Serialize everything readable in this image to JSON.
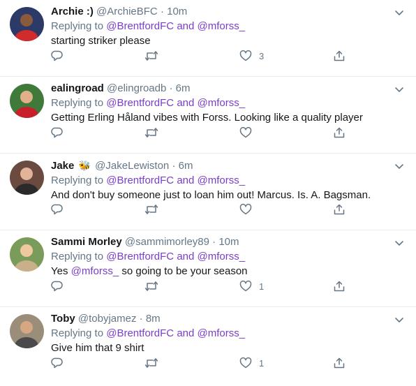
{
  "colors": {
    "link": "#7b3ec7",
    "muted": "#657786",
    "text": "#14171a",
    "divider": "#e6ecf0"
  },
  "icons": [
    "chevron-down-icon",
    "reply-icon",
    "retweet-icon",
    "like-icon",
    "share-icon"
  ],
  "tweets": [
    {
      "name": "Archie :)",
      "emoji": "",
      "handle": "@ArchieBFC",
      "separator": "·",
      "time": "10m",
      "replying_prefix": "Replying to",
      "replying_user1": "@BrentfordFC",
      "replying_and": "and",
      "replying_user2": "@mforss_",
      "text_segments": [
        {
          "text": "starting striker please",
          "link": false
        }
      ],
      "reply_count": "",
      "retweet_count": "",
      "like_count": "3"
    },
    {
      "name": "ealingroad",
      "emoji": "",
      "handle": "@elingroadb",
      "separator": "·",
      "time": "6m",
      "replying_prefix": "Replying to",
      "replying_user1": "@BrentfordFC",
      "replying_and": "and",
      "replying_user2": "@mforss_",
      "text_segments": [
        {
          "text": "Getting Erling Håland vibes with Forss. Looking like a quality player",
          "link": false
        }
      ],
      "reply_count": "",
      "retweet_count": "",
      "like_count": ""
    },
    {
      "name": "Jake",
      "emoji": "🐝",
      "handle": "@JakeLewiston",
      "separator": "·",
      "time": "6m",
      "replying_prefix": "Replying to",
      "replying_user1": "@BrentfordFC",
      "replying_and": "and",
      "replying_user2": "@mforss_",
      "text_segments": [
        {
          "text": "And don't buy someone just to loan him out! Marcus. Is. A. Bagsman.",
          "link": false
        }
      ],
      "reply_count": "",
      "retweet_count": "",
      "like_count": ""
    },
    {
      "name": "Sammi Morley",
      "emoji": "",
      "handle": "@sammimorley89",
      "separator": "·",
      "time": "10m",
      "replying_prefix": "Replying to",
      "replying_user1": "@BrentfordFC",
      "replying_and": "and",
      "replying_user2": "@mforss_",
      "text_segments": [
        {
          "text": "Yes ",
          "link": false
        },
        {
          "text": "@mforss_",
          "link": true
        },
        {
          "text": " so going to be your season",
          "link": false
        }
      ],
      "reply_count": "",
      "retweet_count": "",
      "like_count": "1"
    },
    {
      "name": "Toby",
      "emoji": "",
      "handle": "@tobyjamez",
      "separator": "·",
      "time": "8m",
      "replying_prefix": "Replying to",
      "replying_user1": "@BrentfordFC",
      "replying_and": "and",
      "replying_user2": "@mforss_",
      "text_segments": [
        {
          "text": "Give him that 9 shirt",
          "link": false
        }
      ],
      "reply_count": "",
      "retweet_count": "",
      "like_count": "1"
    }
  ]
}
